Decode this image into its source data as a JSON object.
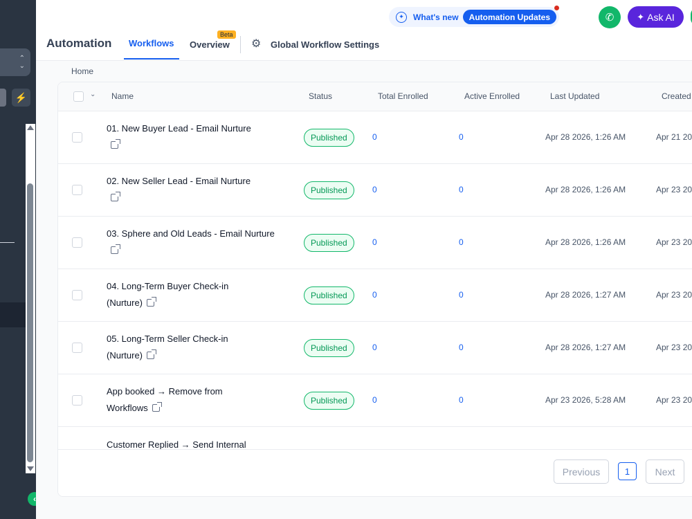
{
  "header": {
    "page_title": "Automation",
    "tabs": [
      {
        "label": "Workflows",
        "active": true
      },
      {
        "label": "Overview",
        "badge": "Beta"
      }
    ],
    "global_settings_label": "Global Workflow Settings",
    "whats_new_label": "What's new",
    "automation_updates_label": "Automation Updates",
    "ask_ai_label": "Ask AI"
  },
  "breadcrumb": "Home",
  "table": {
    "columns": [
      "Name",
      "Status",
      "Total Enrolled",
      "Active Enrolled",
      "Last Updated",
      "Created"
    ],
    "rows": [
      {
        "name": "01. New Buyer Lead - Email Nurture",
        "status": "Published",
        "total": "0",
        "active": "0",
        "updated": "Apr 28 2026, 1:26 AM",
        "created": "Apr 21 20"
      },
      {
        "name": "02. New Seller Lead - Email Nurture",
        "status": "Published",
        "total": "0",
        "active": "0",
        "updated": "Apr 28 2026, 1:26 AM",
        "created": "Apr 23 20"
      },
      {
        "name": "03. Sphere and Old Leads - Email Nurture",
        "status": "Published",
        "total": "0",
        "active": "0",
        "updated": "Apr 28 2026, 1:26 AM",
        "created": "Apr 23 20"
      },
      {
        "name": "04. Long-Term Buyer Check-in (Nurture)",
        "status": "Published",
        "total": "0",
        "active": "0",
        "updated": "Apr 28 2026, 1:27 AM",
        "created": "Apr 23 20"
      },
      {
        "name": "05. Long-Term Seller Check-in (Nurture)",
        "status": "Published",
        "total": "0",
        "active": "0",
        "updated": "Apr 28 2026, 1:27 AM",
        "created": "Apr 23 20"
      },
      {
        "name": "App booked → Remove from Workflows",
        "status": "Published",
        "total": "0",
        "active": "0",
        "updated": "Apr 23 2026, 5:28 AM",
        "created": "Apr 23 20"
      }
    ],
    "partial_row_name": "Customer Replied → Send Internal"
  },
  "pagination": {
    "previous_label": "Previous",
    "current_page": "1",
    "next_label": "Next"
  },
  "colors": {
    "accent": "#155eef",
    "published_green": "#12b76a",
    "sidebar": "#2a3441",
    "ask_ai": "#5925dc"
  }
}
